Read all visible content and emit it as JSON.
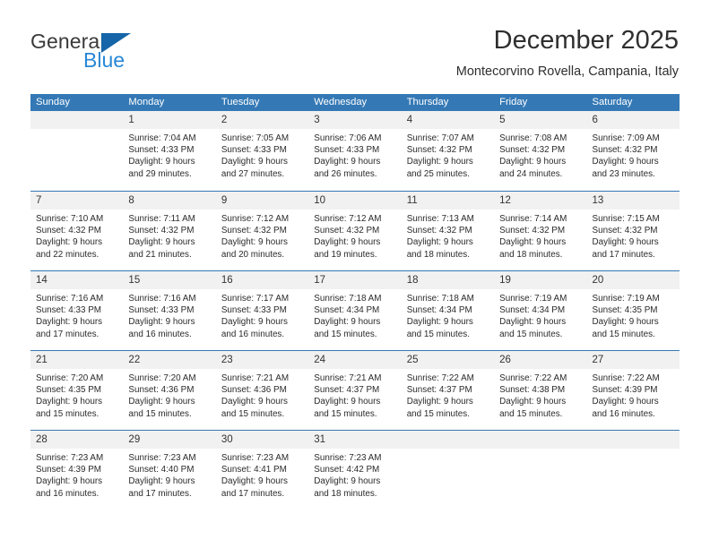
{
  "brand": {
    "name_top": "General",
    "name_bottom": "Blue",
    "accent_color": "#2787d6",
    "triangle_color": "#1565a8"
  },
  "header": {
    "title": "December 2025",
    "subtitle": "Montecorvino Rovella, Campania, Italy"
  },
  "theme": {
    "header_blue": "#3479b5",
    "day_strip_gray": "#f1f1f1",
    "text_color": "#2b2b2b"
  },
  "weekdays": [
    "Sunday",
    "Monday",
    "Tuesday",
    "Wednesday",
    "Thursday",
    "Friday",
    "Saturday"
  ],
  "weeks": [
    [
      {
        "day": "",
        "sunrise": "",
        "sunset": "",
        "daylight_line1": "",
        "daylight_line2": ""
      },
      {
        "day": "1",
        "sunrise": "Sunrise: 7:04 AM",
        "sunset": "Sunset: 4:33 PM",
        "daylight_line1": "Daylight: 9 hours",
        "daylight_line2": "and 29 minutes."
      },
      {
        "day": "2",
        "sunrise": "Sunrise: 7:05 AM",
        "sunset": "Sunset: 4:33 PM",
        "daylight_line1": "Daylight: 9 hours",
        "daylight_line2": "and 27 minutes."
      },
      {
        "day": "3",
        "sunrise": "Sunrise: 7:06 AM",
        "sunset": "Sunset: 4:33 PM",
        "daylight_line1": "Daylight: 9 hours",
        "daylight_line2": "and 26 minutes."
      },
      {
        "day": "4",
        "sunrise": "Sunrise: 7:07 AM",
        "sunset": "Sunset: 4:32 PM",
        "daylight_line1": "Daylight: 9 hours",
        "daylight_line2": "and 25 minutes."
      },
      {
        "day": "5",
        "sunrise": "Sunrise: 7:08 AM",
        "sunset": "Sunset: 4:32 PM",
        "daylight_line1": "Daylight: 9 hours",
        "daylight_line2": "and 24 minutes."
      },
      {
        "day": "6",
        "sunrise": "Sunrise: 7:09 AM",
        "sunset": "Sunset: 4:32 PM",
        "daylight_line1": "Daylight: 9 hours",
        "daylight_line2": "and 23 minutes."
      }
    ],
    [
      {
        "day": "7",
        "sunrise": "Sunrise: 7:10 AM",
        "sunset": "Sunset: 4:32 PM",
        "daylight_line1": "Daylight: 9 hours",
        "daylight_line2": "and 22 minutes."
      },
      {
        "day": "8",
        "sunrise": "Sunrise: 7:11 AM",
        "sunset": "Sunset: 4:32 PM",
        "daylight_line1": "Daylight: 9 hours",
        "daylight_line2": "and 21 minutes."
      },
      {
        "day": "9",
        "sunrise": "Sunrise: 7:12 AM",
        "sunset": "Sunset: 4:32 PM",
        "daylight_line1": "Daylight: 9 hours",
        "daylight_line2": "and 20 minutes."
      },
      {
        "day": "10",
        "sunrise": "Sunrise: 7:12 AM",
        "sunset": "Sunset: 4:32 PM",
        "daylight_line1": "Daylight: 9 hours",
        "daylight_line2": "and 19 minutes."
      },
      {
        "day": "11",
        "sunrise": "Sunrise: 7:13 AM",
        "sunset": "Sunset: 4:32 PM",
        "daylight_line1": "Daylight: 9 hours",
        "daylight_line2": "and 18 minutes."
      },
      {
        "day": "12",
        "sunrise": "Sunrise: 7:14 AM",
        "sunset": "Sunset: 4:32 PM",
        "daylight_line1": "Daylight: 9 hours",
        "daylight_line2": "and 18 minutes."
      },
      {
        "day": "13",
        "sunrise": "Sunrise: 7:15 AM",
        "sunset": "Sunset: 4:32 PM",
        "daylight_line1": "Daylight: 9 hours",
        "daylight_line2": "and 17 minutes."
      }
    ],
    [
      {
        "day": "14",
        "sunrise": "Sunrise: 7:16 AM",
        "sunset": "Sunset: 4:33 PM",
        "daylight_line1": "Daylight: 9 hours",
        "daylight_line2": "and 17 minutes."
      },
      {
        "day": "15",
        "sunrise": "Sunrise: 7:16 AM",
        "sunset": "Sunset: 4:33 PM",
        "daylight_line1": "Daylight: 9 hours",
        "daylight_line2": "and 16 minutes."
      },
      {
        "day": "16",
        "sunrise": "Sunrise: 7:17 AM",
        "sunset": "Sunset: 4:33 PM",
        "daylight_line1": "Daylight: 9 hours",
        "daylight_line2": "and 16 minutes."
      },
      {
        "day": "17",
        "sunrise": "Sunrise: 7:18 AM",
        "sunset": "Sunset: 4:34 PM",
        "daylight_line1": "Daylight: 9 hours",
        "daylight_line2": "and 15 minutes."
      },
      {
        "day": "18",
        "sunrise": "Sunrise: 7:18 AM",
        "sunset": "Sunset: 4:34 PM",
        "daylight_line1": "Daylight: 9 hours",
        "daylight_line2": "and 15 minutes."
      },
      {
        "day": "19",
        "sunrise": "Sunrise: 7:19 AM",
        "sunset": "Sunset: 4:34 PM",
        "daylight_line1": "Daylight: 9 hours",
        "daylight_line2": "and 15 minutes."
      },
      {
        "day": "20",
        "sunrise": "Sunrise: 7:19 AM",
        "sunset": "Sunset: 4:35 PM",
        "daylight_line1": "Daylight: 9 hours",
        "daylight_line2": "and 15 minutes."
      }
    ],
    [
      {
        "day": "21",
        "sunrise": "Sunrise: 7:20 AM",
        "sunset": "Sunset: 4:35 PM",
        "daylight_line1": "Daylight: 9 hours",
        "daylight_line2": "and 15 minutes."
      },
      {
        "day": "22",
        "sunrise": "Sunrise: 7:20 AM",
        "sunset": "Sunset: 4:36 PM",
        "daylight_line1": "Daylight: 9 hours",
        "daylight_line2": "and 15 minutes."
      },
      {
        "day": "23",
        "sunrise": "Sunrise: 7:21 AM",
        "sunset": "Sunset: 4:36 PM",
        "daylight_line1": "Daylight: 9 hours",
        "daylight_line2": "and 15 minutes."
      },
      {
        "day": "24",
        "sunrise": "Sunrise: 7:21 AM",
        "sunset": "Sunset: 4:37 PM",
        "daylight_line1": "Daylight: 9 hours",
        "daylight_line2": "and 15 minutes."
      },
      {
        "day": "25",
        "sunrise": "Sunrise: 7:22 AM",
        "sunset": "Sunset: 4:37 PM",
        "daylight_line1": "Daylight: 9 hours",
        "daylight_line2": "and 15 minutes."
      },
      {
        "day": "26",
        "sunrise": "Sunrise: 7:22 AM",
        "sunset": "Sunset: 4:38 PM",
        "daylight_line1": "Daylight: 9 hours",
        "daylight_line2": "and 15 minutes."
      },
      {
        "day": "27",
        "sunrise": "Sunrise: 7:22 AM",
        "sunset": "Sunset: 4:39 PM",
        "daylight_line1": "Daylight: 9 hours",
        "daylight_line2": "and 16 minutes."
      }
    ],
    [
      {
        "day": "28",
        "sunrise": "Sunrise: 7:23 AM",
        "sunset": "Sunset: 4:39 PM",
        "daylight_line1": "Daylight: 9 hours",
        "daylight_line2": "and 16 minutes."
      },
      {
        "day": "29",
        "sunrise": "Sunrise: 7:23 AM",
        "sunset": "Sunset: 4:40 PM",
        "daylight_line1": "Daylight: 9 hours",
        "daylight_line2": "and 17 minutes."
      },
      {
        "day": "30",
        "sunrise": "Sunrise: 7:23 AM",
        "sunset": "Sunset: 4:41 PM",
        "daylight_line1": "Daylight: 9 hours",
        "daylight_line2": "and 17 minutes."
      },
      {
        "day": "31",
        "sunrise": "Sunrise: 7:23 AM",
        "sunset": "Sunset: 4:42 PM",
        "daylight_line1": "Daylight: 9 hours",
        "daylight_line2": "and 18 minutes."
      },
      {
        "day": "",
        "sunrise": "",
        "sunset": "",
        "daylight_line1": "",
        "daylight_line2": ""
      },
      {
        "day": "",
        "sunrise": "",
        "sunset": "",
        "daylight_line1": "",
        "daylight_line2": ""
      },
      {
        "day": "",
        "sunrise": "",
        "sunset": "",
        "daylight_line1": "",
        "daylight_line2": ""
      }
    ]
  ]
}
